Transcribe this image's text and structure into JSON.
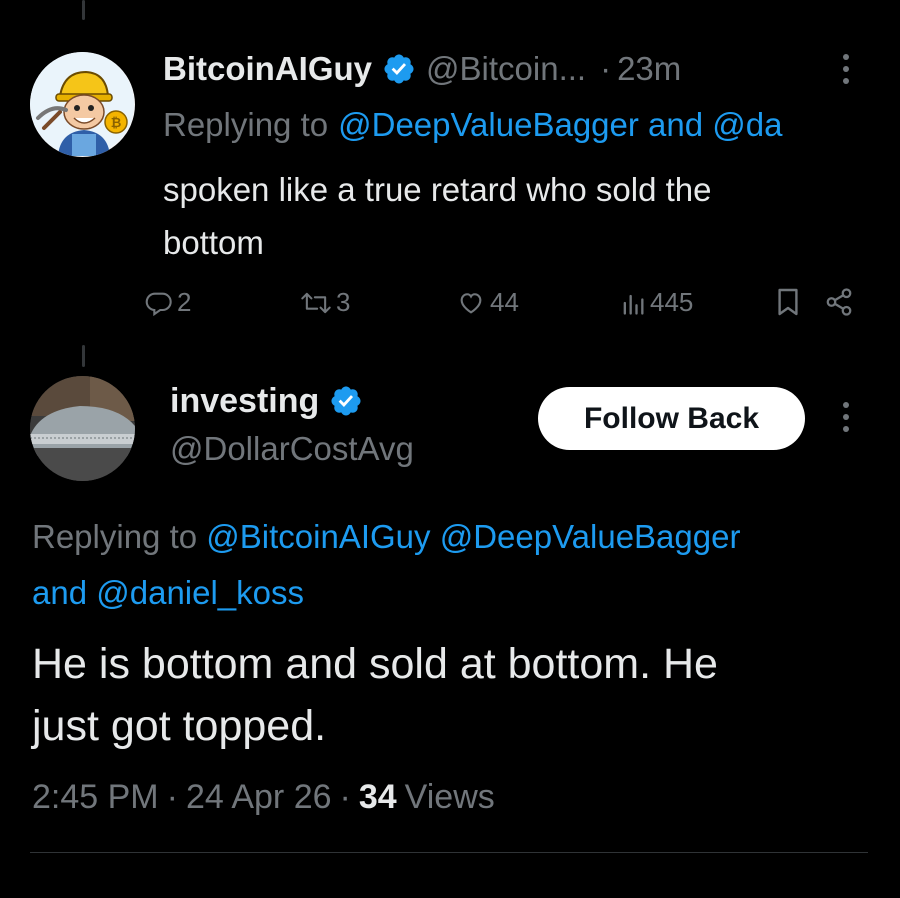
{
  "reply_tweet": {
    "display_name": "BitcoinAIGuy",
    "handle": "@Bitcoin...",
    "separator": "·",
    "time_ago": "23m",
    "replying_prefix": "Replying to",
    "replying_mentions": "@DeepValueBagger and @da",
    "text_line1": "spoken like a true retard who sold the",
    "text_line2": "bottom",
    "actions": {
      "replies": "2",
      "reposts": "3",
      "likes": "44",
      "views": "445"
    }
  },
  "main_tweet": {
    "display_name": "investing",
    "handle": "@DollarCostAvg",
    "follow_label": "Follow Back",
    "replying_prefix": "Replying to",
    "replying_mention1": "@BitcoinAIGuy",
    "replying_mention2": "@DeepValueBagger",
    "replying_and": "and",
    "replying_mention3": "@daniel_koss",
    "text_line1": "He is bottom and sold at bottom. He",
    "text_line2": "just got topped.",
    "time": "2:45 PM",
    "sep1": "·",
    "date": "24 Apr 26",
    "sep2": "·",
    "views_count": "34",
    "views_label": "Views"
  },
  "colors": {
    "background": "#000000",
    "text": "#e7e9ea",
    "muted": "#71767b",
    "link": "#1d9bf0",
    "verified": "#1d9bf0"
  },
  "icons": [
    "reply-icon",
    "repost-icon",
    "like-icon",
    "views-icon",
    "bookmark-icon",
    "share-icon",
    "more-icon",
    "verified-badge-icon"
  ]
}
